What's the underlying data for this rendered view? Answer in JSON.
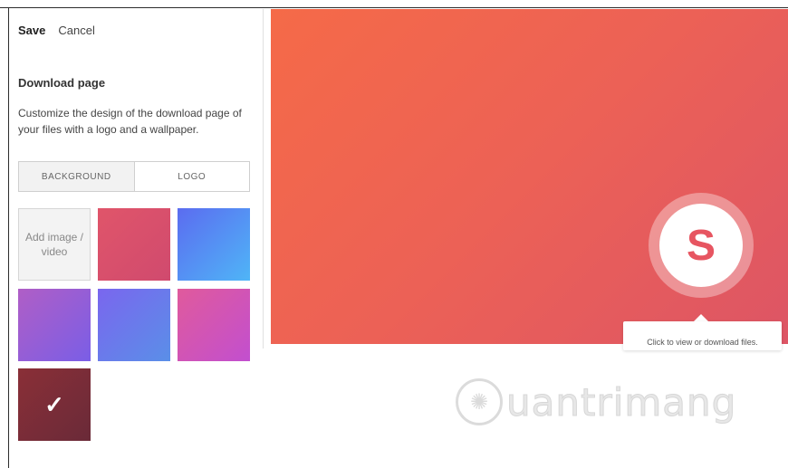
{
  "toolbar": {
    "save_label": "Save",
    "cancel_label": "Cancel"
  },
  "panel": {
    "heading": "Download page",
    "description": "Customize the design of the download page of your files with a logo and a wallpaper."
  },
  "tabs": [
    {
      "label": "BACKGROUND",
      "selected": true
    },
    {
      "label": "LOGO",
      "selected": false
    }
  ],
  "backgrounds": {
    "add_label": "Add image / video",
    "selected_check": "✓",
    "swatches": [
      {
        "colors": [
          "#e0556a",
          "#d04a6e"
        ]
      },
      {
        "colors": [
          "#5b6cf0",
          "#4fb5f7"
        ]
      },
      {
        "colors": [
          "#b05ec6",
          "#7a5ee6"
        ]
      },
      {
        "colors": [
          "#7a66ee",
          "#5a8fe8"
        ]
      },
      {
        "colors": [
          "#e05a9c",
          "#c24fcf"
        ]
      },
      {
        "colors": [
          "#8a2f37",
          "#6a2a38"
        ],
        "selected": true
      }
    ]
  },
  "preview": {
    "logo_letter": "S",
    "tooltip_text": "Click to view or download files.",
    "background_colors": [
      "#f56a48",
      "#dd5565"
    ]
  },
  "watermark": {
    "text": "uantrimang",
    "icon": "lightbulb-icon"
  }
}
